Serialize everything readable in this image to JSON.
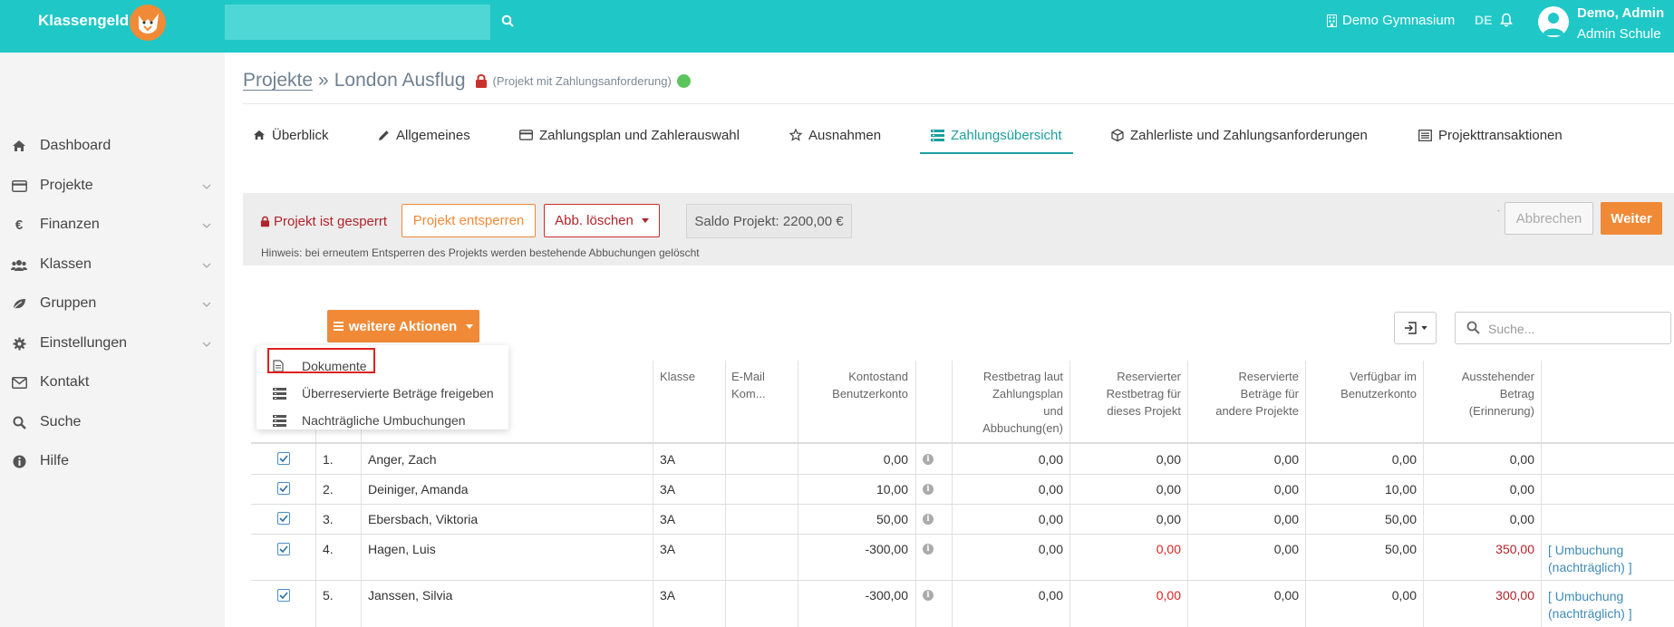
{
  "header": {
    "brand": "Klassengeld",
    "search_value": "",
    "school": "Demo Gymnasium",
    "lang": "DE",
    "user_name": "Demo, Admin",
    "user_school": "Admin Schule"
  },
  "sidebar": {
    "items": [
      {
        "label": "Dashboard",
        "icon": "home-icon",
        "chevron": false
      },
      {
        "label": "Projekte",
        "icon": "credit-card-icon",
        "chevron": true
      },
      {
        "label": "Finanzen",
        "icon": "euro-icon",
        "chevron": true
      },
      {
        "label": "Klassen",
        "icon": "users-icon",
        "chevron": true
      },
      {
        "label": "Gruppen",
        "icon": "leaf-icon",
        "chevron": true
      },
      {
        "label": "Einstellungen",
        "icon": "gear-icon",
        "chevron": true
      },
      {
        "label": "Kontakt",
        "icon": "envelope-icon",
        "chevron": false
      },
      {
        "label": "Suche",
        "icon": "search-icon",
        "chevron": false
      },
      {
        "label": "Hilfe",
        "icon": "info-icon",
        "chevron": false
      }
    ]
  },
  "breadcrumb": {
    "root": "Projekte",
    "sep": "»",
    "current": "London Ausflug",
    "hint": "(Projekt mit Zahlungsanforderung)"
  },
  "tabs": [
    {
      "label": "Überblick"
    },
    {
      "label": "Allgemeines"
    },
    {
      "label": "Zahlungsplan und Zahlerauswahl"
    },
    {
      "label": "Ausnahmen"
    },
    {
      "label": "Zahlungsübersicht",
      "active": true
    },
    {
      "label": "Zahlerliste und Zahlungsanforderungen"
    },
    {
      "label": "Projekttransaktionen"
    }
  ],
  "panel": {
    "locked": "Projekt ist gesperrt",
    "unlock": "Projekt entsperren",
    "abb_delete": "Abb. löschen",
    "saldo": "Saldo Projekt: 2200,00 €",
    "hint": "Hinweis: bei erneutem Entsperren des Projekts werden bestehende Abbuchungen gelöscht",
    "tick": "`",
    "cancel": "Abbrechen",
    "next": "Weiter"
  },
  "actions": {
    "button": "weitere Aktionen",
    "menu": [
      "Dokumente",
      "Überreservierte Beträge freigeben",
      "Nachträgliche Umbuchungen"
    ]
  },
  "search": {
    "placeholder": "Suche..."
  },
  "table": {
    "headers": {
      "klasse": "Klasse",
      "email": [
        "E-Mail",
        "Kom..."
      ],
      "kontostand": [
        "Kontostand",
        "Benutzerkonto"
      ],
      "restbetrag": [
        "Restbetrag laut",
        "Zahlungsplan",
        "und",
        "Abbuchung(en)"
      ],
      "res_projekt": [
        "Reservierter",
        "Restbetrag für",
        "dieses Projekt"
      ],
      "res_andere": [
        "Reservierte",
        "Beträge für",
        "andere Projekte"
      ],
      "verfuegbar": [
        "Verfügbar im",
        "Benutzerkonto"
      ],
      "ausstehend": [
        "Ausstehender",
        "Betrag",
        "(Erinnerung)"
      ]
    },
    "rows": [
      {
        "nr": "1.",
        "name": "Anger, Zach",
        "klasse": "3A",
        "kontostand": "0,00",
        "restbetrag": "0,00",
        "res_projekt": "0,00",
        "res_andere": "0,00",
        "verfuegbar": "0,00",
        "ausstehend": "0,00",
        "action": ""
      },
      {
        "nr": "2.",
        "name": "Deiniger, Amanda",
        "klasse": "3A",
        "kontostand": "10,00",
        "restbetrag": "0,00",
        "res_projekt": "0,00",
        "res_andere": "0,00",
        "verfuegbar": "10,00",
        "ausstehend": "0,00",
        "action": ""
      },
      {
        "nr": "3.",
        "name": "Ebersbach, Viktoria",
        "klasse": "3A",
        "kontostand": "50,00",
        "restbetrag": "0,00",
        "res_projekt": "0,00",
        "res_andere": "0,00",
        "verfuegbar": "50,00",
        "ausstehend": "0,00",
        "action": ""
      },
      {
        "nr": "4.",
        "name": "Hagen, Luis",
        "klasse": "3A",
        "kontostand": "-300,00",
        "restbetrag": "0,00",
        "res_projekt": "0,00",
        "res_andere": "0,00",
        "verfuegbar": "50,00",
        "ausstehend": "350,00",
        "action": "[ Umbuchung (nachträglich) ]"
      },
      {
        "nr": "5.",
        "name": "Janssen, Silvia",
        "klasse": "3A",
        "kontostand": "-300,00",
        "restbetrag": "0,00",
        "res_projekt": "0,00",
        "res_andere": "0,00",
        "verfuegbar": "0,00",
        "ausstehend": "300,00",
        "action": "[ Umbuchung (nachträglich) ]"
      }
    ]
  },
  "colors": {
    "topbar": "#1fc8c7",
    "accent": "#f08a37",
    "danger": "#b2232a",
    "active_tab": "#1d9f9e"
  }
}
